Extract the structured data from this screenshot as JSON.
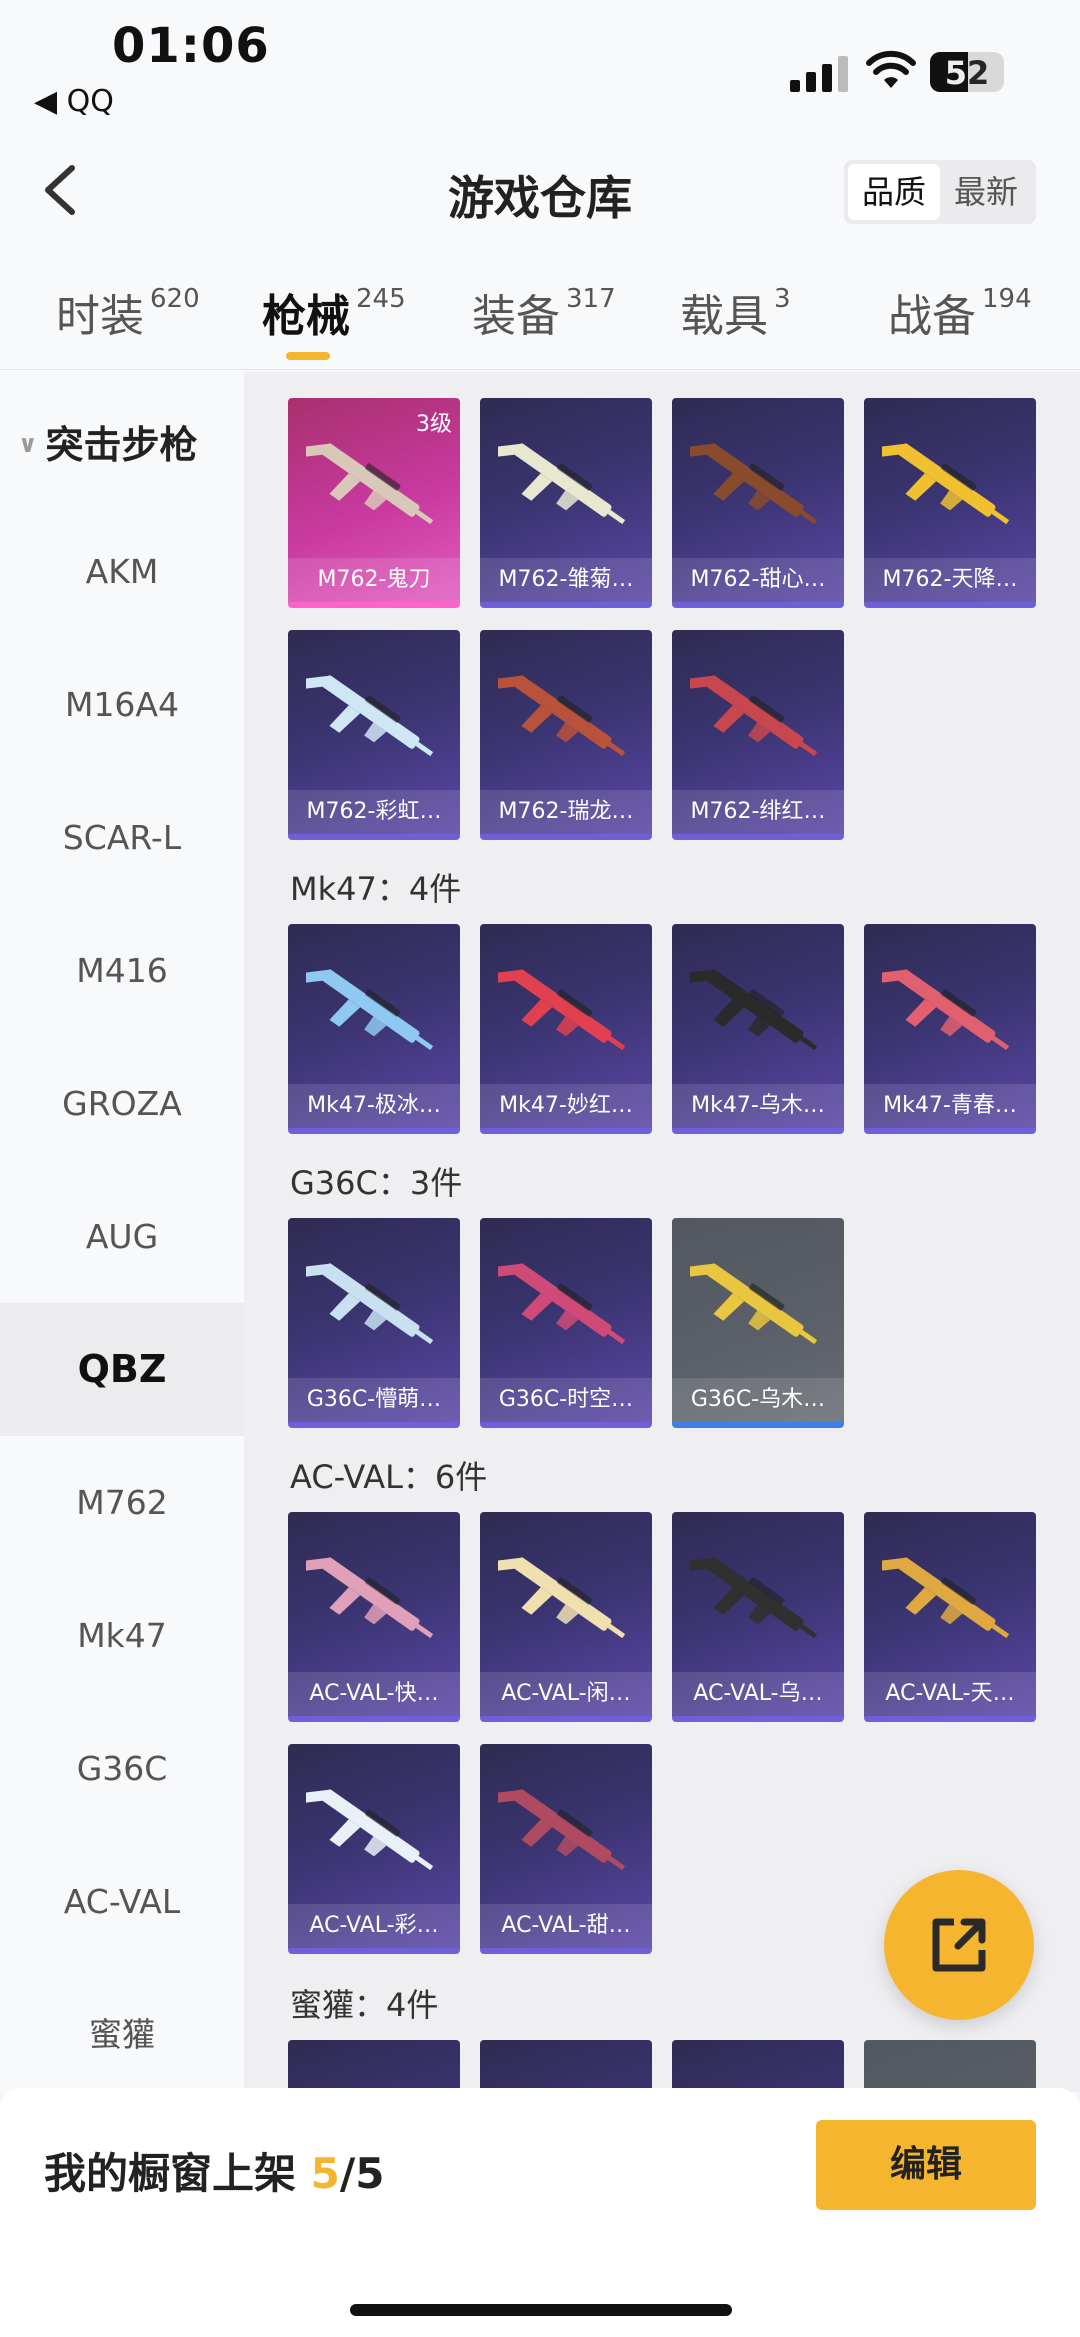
{
  "status_bar": {
    "time": "01:06",
    "back_app": "◀ QQ",
    "battery": "52"
  },
  "header": {
    "title": "游戏仓库",
    "sort": [
      "品质",
      "最新"
    ]
  },
  "tabs": [
    {
      "label": "时装",
      "count": "620"
    },
    {
      "label": "枪械",
      "count": "245"
    },
    {
      "label": "装备",
      "count": "317"
    },
    {
      "label": "载具",
      "count": "3"
    },
    {
      "label": "战备",
      "count": "194"
    }
  ],
  "sidebar": {
    "group": "突击步枪",
    "items": [
      "AKM",
      "M16A4",
      "SCAR-L",
      "M416",
      "GROZA",
      "AUG",
      "QBZ",
      "M762",
      "Mk47",
      "G36C",
      "AC-VAL",
      "蜜獾"
    ]
  },
  "sections": [
    {
      "title": "",
      "items": [
        {
          "name": "M762-鬼刀",
          "level": "3级"
        },
        {
          "name": "M762-雏菊…"
        },
        {
          "name": "M762-甜心…"
        },
        {
          "name": "M762-天降…"
        },
        {
          "name": "M762-彩虹…"
        },
        {
          "name": "M762-瑞龙…"
        },
        {
          "name": "M762-绯红…"
        }
      ]
    },
    {
      "title": "Mk47：4件",
      "items": [
        {
          "name": "Mk47-极冰…"
        },
        {
          "name": "Mk47-妙红…"
        },
        {
          "name": "Mk47-乌木…"
        },
        {
          "name": "Mk47-青春…"
        }
      ]
    },
    {
      "title": "G36C：3件",
      "items": [
        {
          "name": "G36C-懵萌…"
        },
        {
          "name": "G36C-时空…"
        },
        {
          "name": "G36C-乌木…"
        }
      ]
    },
    {
      "title": "AC-VAL：6件",
      "items": [
        {
          "name": "AC-VAL-快…"
        },
        {
          "name": "AC-VAL-闲…"
        },
        {
          "name": "AC-VAL-乌…"
        },
        {
          "name": "AC-VAL-天…"
        },
        {
          "name": "AC-VAL-彩…"
        },
        {
          "name": "AC-VAL-甜…"
        }
      ]
    },
    {
      "title": "蜜獾：4件",
      "items": []
    }
  ],
  "bottom": {
    "showcase_label": "我的橱窗上架",
    "count": "5",
    "total": "/5",
    "edit": "编辑"
  },
  "colors": {
    "accent": "#f5b52e",
    "card_purple": "#3a3470",
    "card_pink": "#c93aa0",
    "card_grey": "#5c6068"
  },
  "icons": {
    "back": "chevron-left-icon",
    "share": "share-export-icon"
  }
}
